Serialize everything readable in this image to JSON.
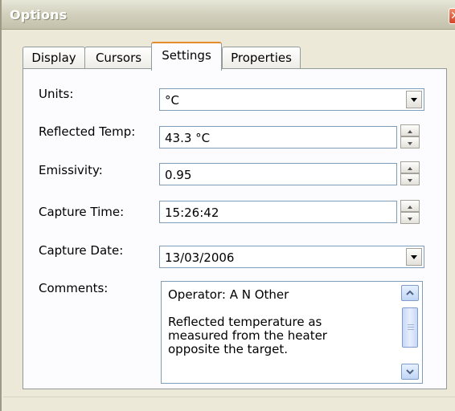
{
  "window": {
    "title": "Options",
    "close_label": "✕"
  },
  "tabs": [
    {
      "label": "Display",
      "active": false
    },
    {
      "label": "Cursors",
      "active": false
    },
    {
      "label": "Settings",
      "active": true
    },
    {
      "label": "Properties",
      "active": false
    }
  ],
  "settings": {
    "units": {
      "label": "Units:",
      "value": "°C"
    },
    "reflected_temp": {
      "label": "Reflected Temp:",
      "value": "43.3 °C"
    },
    "emissivity": {
      "label": "Emissivity:",
      "value": "0.95"
    },
    "capture_time": {
      "label": "Capture Time:",
      "value": "15:26:42"
    },
    "capture_date": {
      "label": "Capture Date:",
      "value": "13/03/2006"
    },
    "comments": {
      "label": "Comments:",
      "line1": "Operator: A N Other",
      "line2": "Reflected temperature as",
      "line3": "measured from the heater",
      "line4": "opposite the target."
    }
  }
}
